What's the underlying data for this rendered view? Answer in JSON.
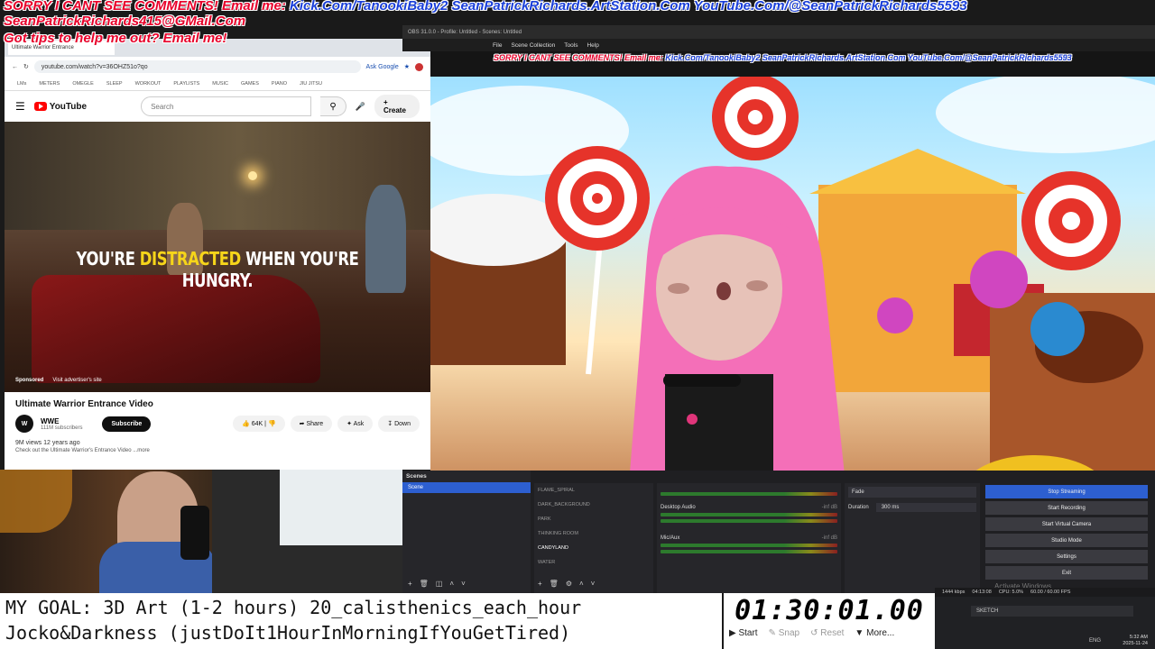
{
  "overlay": {
    "line1_red": "SORRY I CANT SEE COMMENTS! Email me:",
    "line1_blue": "Kick.Com/TanookiBaby2 SeanPatrickRichards.ArtStation.Com YouTube.Com/@SeanPatrickRichards5593",
    "line2": "SeanPatrickRichards415@GMail.Com",
    "line3": "Got tips to help me out? Email me!"
  },
  "browser": {
    "tab_title": "Ultimate Warrior Entrance",
    "url": "youtube.com/watch?v=36OHZ51o?qo",
    "ask_google": "Ask Google",
    "bookmarks": [
      "LMs",
      "METERS",
      "OMEGLE",
      "SLEEP",
      "WORKOUT",
      "PLAYLISTS",
      "MUSIC",
      "GAMES",
      "PIANO",
      "JIU JITSU"
    ]
  },
  "youtube": {
    "brand": "YouTube",
    "search_placeholder": "Search",
    "create": "Create",
    "video_caption_pre": "YOU'RE ",
    "video_caption_hl": "DISTRACTED",
    "video_caption_post": " WHEN YOU'RE HUNGRY.",
    "sponsored": "Sponsored",
    "visit_advertiser": "Visit advertiser's site",
    "title": "Ultimate Warrior Entrance Video",
    "channel": "WWE",
    "subscribers": "111M subscribers",
    "subscribe": "Subscribe",
    "likes": "64K",
    "share": "Share",
    "ask": "Ask",
    "download": "Down",
    "views": "9M views  12 years ago",
    "desc": "Check out the Ultimate Warrior's Entrance Video ...more"
  },
  "obs": {
    "window_title": "OBS 31.0.0 - Profile: Untitled - Scenes: Untitled",
    "menu": [
      "File",
      "Scene Collection",
      "Tools",
      "Help"
    ],
    "scenes_header": "Scenes",
    "scene_item": "Scene",
    "sources": [
      "FLAME_SPIRAL",
      "DARK_BACKGROUND",
      "PARK",
      "THINKING ROOM",
      "CANDYLAND",
      "WATER"
    ],
    "audio": [
      {
        "name": "Desktop Audio",
        "db": "-inf dB"
      },
      {
        "name": "Mic/Aux",
        "db": "-inf dB"
      }
    ],
    "transition": "Fade",
    "duration_label": "Duration",
    "duration_value": "300 ms",
    "controls": [
      "Stop Streaming",
      "Start Recording",
      "Start Virtual Camera",
      "Studio Mode",
      "Settings",
      "Exit"
    ],
    "status_kbps": "1444 kbps",
    "status_time": "04:13:08",
    "status_cpu": "CPU: 5.0%",
    "status_fps": "60.00 / 60.00 FPS",
    "activate_windows": "Activate Windows"
  },
  "goal": {
    "line1": "MY GOAL: 3D Art (1-2 hours) 20_calisthenics_each_hour",
    "line2": "Jocko&Darkness (justDoIt1HourInMorningIfYouGetTired)"
  },
  "stopwatch": {
    "time": "01:30:01.00",
    "start": "Start",
    "snap": "Snap",
    "reset": "Reset",
    "more": "More..."
  },
  "taskbar": {
    "item": "SKETCH",
    "lang": "ENG",
    "clock": "5:32 AM",
    "date": "2025-11-24"
  },
  "colors": {
    "accent": "#2d5fd0",
    "overlay_red": "#e8002a",
    "overlay_blue": "#1a3fd8"
  }
}
